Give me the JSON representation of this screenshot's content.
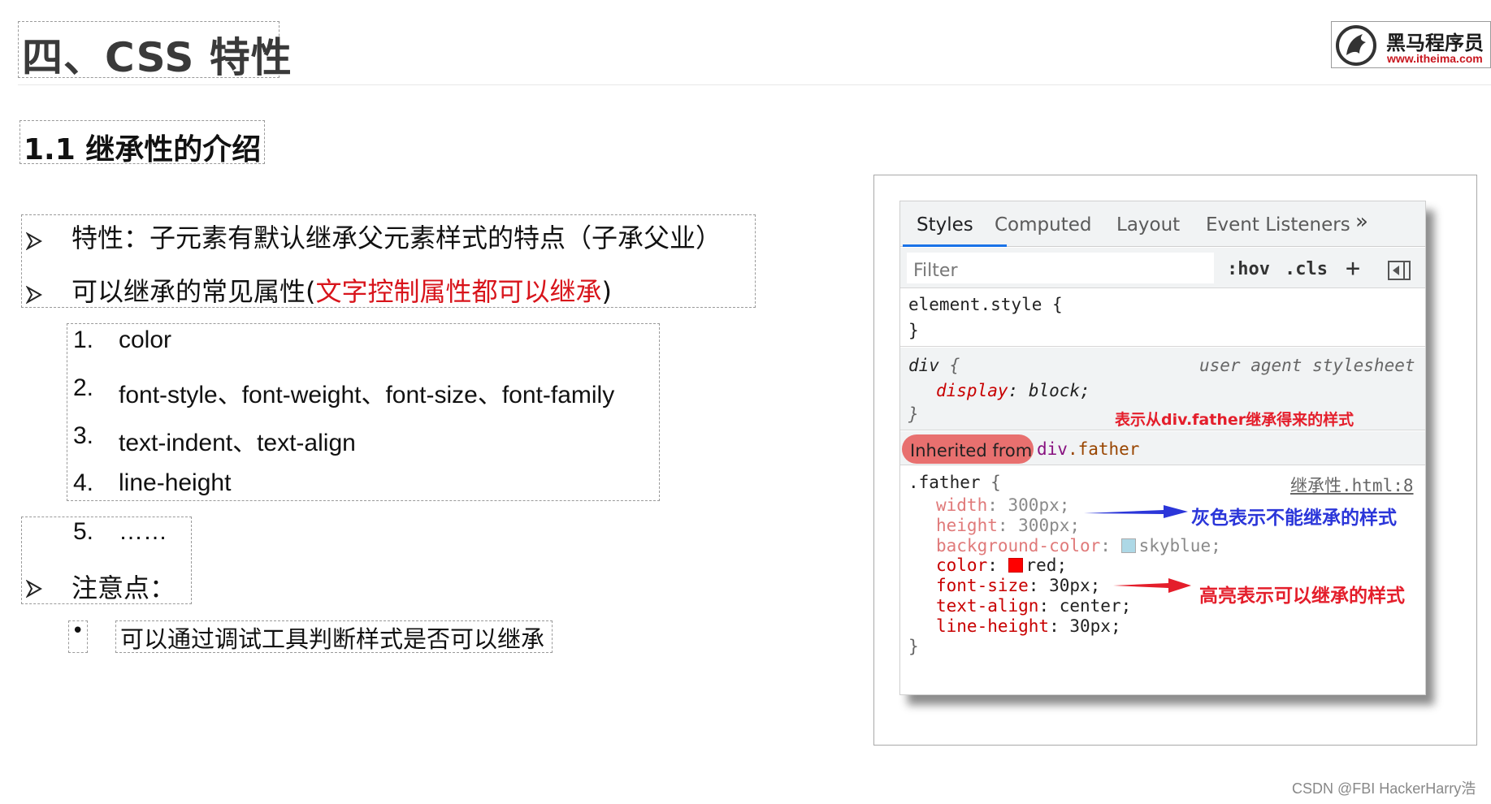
{
  "header": {
    "title": "四、CSS 特性",
    "logo_cn": "黑马程序员",
    "logo_url": "www.itheima.com"
  },
  "subtitle": "1.1 继承性的介绍",
  "bullets": {
    "b1": "特性：子元素有默认继承父元素样式的特点（子承父业）",
    "b2_prefix": "可以继承的常见属性(",
    "b2_red": "文字控制属性都可以继承",
    "b2_suffix": ")",
    "list": [
      {
        "num": "1.",
        "text": "color"
      },
      {
        "num": "2.",
        "text": "font-style、font-weight、font-size、font-family"
      },
      {
        "num": "3.",
        "text": "text-indent、text-align"
      },
      {
        "num": "4.",
        "text": "line-height"
      },
      {
        "num": "5.",
        "text": "……"
      }
    ],
    "b3": "注意点：",
    "dot": "•",
    "sub": "可以通过调试工具判断样式是否可以继承"
  },
  "devtools": {
    "tabs": [
      "Styles",
      "Computed",
      "Layout",
      "Event Listeners"
    ],
    "more": "»",
    "filter_placeholder": "Filter",
    "hov": ":hov",
    "cls": ".cls",
    "plus": "+",
    "element_style_open": "element.style {",
    "close_brace": "}",
    "div_sel": "div",
    "open_brace": "{",
    "ua_label": "user agent stylesheet",
    "display_prop": "display",
    "display_val": "block;",
    "inherited_label": "Inherited from",
    "inherited_tag": "div",
    "inherited_class": ".father",
    "father_sel": ".father",
    "source_link": "继承性.html:8",
    "decls": [
      {
        "prop": "width",
        "val": "300px;"
      },
      {
        "prop": "height",
        "val": "300px;"
      },
      {
        "prop": "background-color",
        "val": "skyblue;"
      },
      {
        "prop": "color",
        "val": "red;"
      },
      {
        "prop": "font-size",
        "val": "30px;"
      },
      {
        "prop": "text-align",
        "val": "center;"
      },
      {
        "prop": "line-height",
        "val": "30px;"
      }
    ]
  },
  "notes": {
    "inherited_note": "表示从div.father继承得来的样式",
    "grey_note": "灰色表示不能继承的样式",
    "highlight_note": "高亮表示可以继承的样式"
  },
  "colors": {
    "accent_red": "#d8141b",
    "arrow_blue": "#2b36d9",
    "arrow_red": "#e41e2b",
    "skyblue": "#87ceeb",
    "red_swatch": "#ff0000",
    "tab_active": "#1a73e8"
  },
  "watermark": "CSDN @FBI HackerHarry浩"
}
